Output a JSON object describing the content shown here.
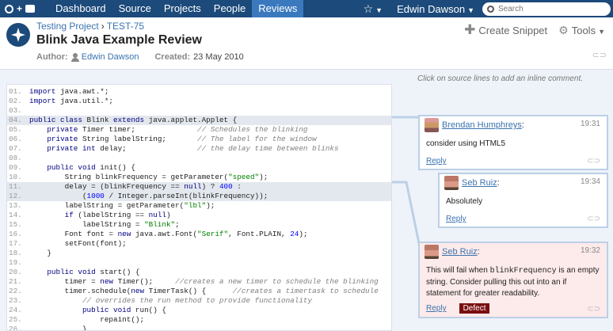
{
  "nav": {
    "items": [
      "Dashboard",
      "Source",
      "Projects",
      "People",
      "Reviews"
    ],
    "active": "Reviews",
    "user": "Edwin Dawson",
    "search_placeholder": "Search"
  },
  "header": {
    "project": "Testing Project",
    "review_id": "TEST-75",
    "title": "Blink Java Example Review",
    "author_label": "Author:",
    "author": "Edwin Dawson",
    "created_label": "Created:",
    "created": "23 May 2010",
    "create_snippet": "Create Snippet",
    "tools": "Tools"
  },
  "hint": "Click on source lines to add an inline comment.",
  "code_lines": [
    {
      "n": "01.",
      "html": "<span class='kw'>import</span> java.awt.*;"
    },
    {
      "n": "02.",
      "html": "<span class='kw'>import</span> java.util.*;"
    },
    {
      "n": "03.",
      "html": ""
    },
    {
      "n": "04.",
      "html": "<span class='kw'>public class</span> Blink <span class='kw'>extends</span> java.applet.Applet {",
      "hl": true
    },
    {
      "n": "05.",
      "html": "    <span class='kw'>private</span> Timer timer;              <span class='cm'>// Schedules the blinking</span>"
    },
    {
      "n": "06.",
      "html": "    <span class='kw'>private</span> String labelString;       <span class='cm'>// The label for the window</span>"
    },
    {
      "n": "07.",
      "html": "    <span class='kw'>private int</span> delay;                <span class='cm'>// the delay time between blinks</span>"
    },
    {
      "n": "08.",
      "html": ""
    },
    {
      "n": "09.",
      "html": "    <span class='kw'>public void</span> init() {"
    },
    {
      "n": "10.",
      "html": "        String blinkFrequency = getParameter(<span class='st'>\"speed\"</span>);"
    },
    {
      "n": "11.",
      "html": "        delay = (blinkFrequency == <span class='kw'>null</span>) ? <span class='nu'>400</span> :",
      "hl": true
    },
    {
      "n": "12.",
      "html": "            (<span class='nu'>1000</span> / Integer.parseInt(blinkFrequency));",
      "hl": true
    },
    {
      "n": "13.",
      "html": "        labelString = getParameter(<span class='st'>\"lbl\"</span>);"
    },
    {
      "n": "14.",
      "html": "        <span class='kw'>if</span> (labelString == <span class='kw'>null</span>)"
    },
    {
      "n": "15.",
      "html": "            labelString = <span class='st'>\"Blink\"</span>;"
    },
    {
      "n": "16.",
      "html": "        Font font = <span class='kw'>new</span> java.awt.Font(<span class='st'>\"Serif\"</span>, Font.PLAIN, <span class='nu'>24</span>);"
    },
    {
      "n": "17.",
      "html": "        setFont(font);"
    },
    {
      "n": "18.",
      "html": "    }"
    },
    {
      "n": "19.",
      "html": ""
    },
    {
      "n": "20.",
      "html": "    <span class='kw'>public void</span> start() {"
    },
    {
      "n": "21.",
      "html": "        timer = <span class='kw'>new</span> Timer();     <span class='cm'>//creates a new timer to schedule the blinking</span>"
    },
    {
      "n": "22.",
      "html": "        timer.schedule(<span class='kw'>new</span> TimerTask() {      <span class='cm'>//creates a timertask to schedule</span>"
    },
    {
      "n": "23.",
      "html": "            <span class='cm'>// overrides the run method to provide functionality</span>"
    },
    {
      "n": "24.",
      "html": "            <span class='kw'>public void</span> run() {"
    },
    {
      "n": "25.",
      "html": "                repaint();"
    },
    {
      "n": "26.",
      "html": "            }"
    }
  ],
  "comments": [
    {
      "author": "Brendan Humphreys",
      "time": "19:31",
      "text": "consider using HTML5",
      "reply": "Reply"
    },
    {
      "author": "Seb Ruiz",
      "time": "19:34",
      "text": "Absolutely",
      "reply": "Reply"
    },
    {
      "author": "Seb Ruiz",
      "time": "19:32",
      "text_pre": "This will fail when ",
      "text_code": "blinkFrequency",
      "text_post": " is an empty string. Consider pulling this out into an if statement for greater readability.",
      "reply": "Reply",
      "badge": "Defect"
    }
  ]
}
